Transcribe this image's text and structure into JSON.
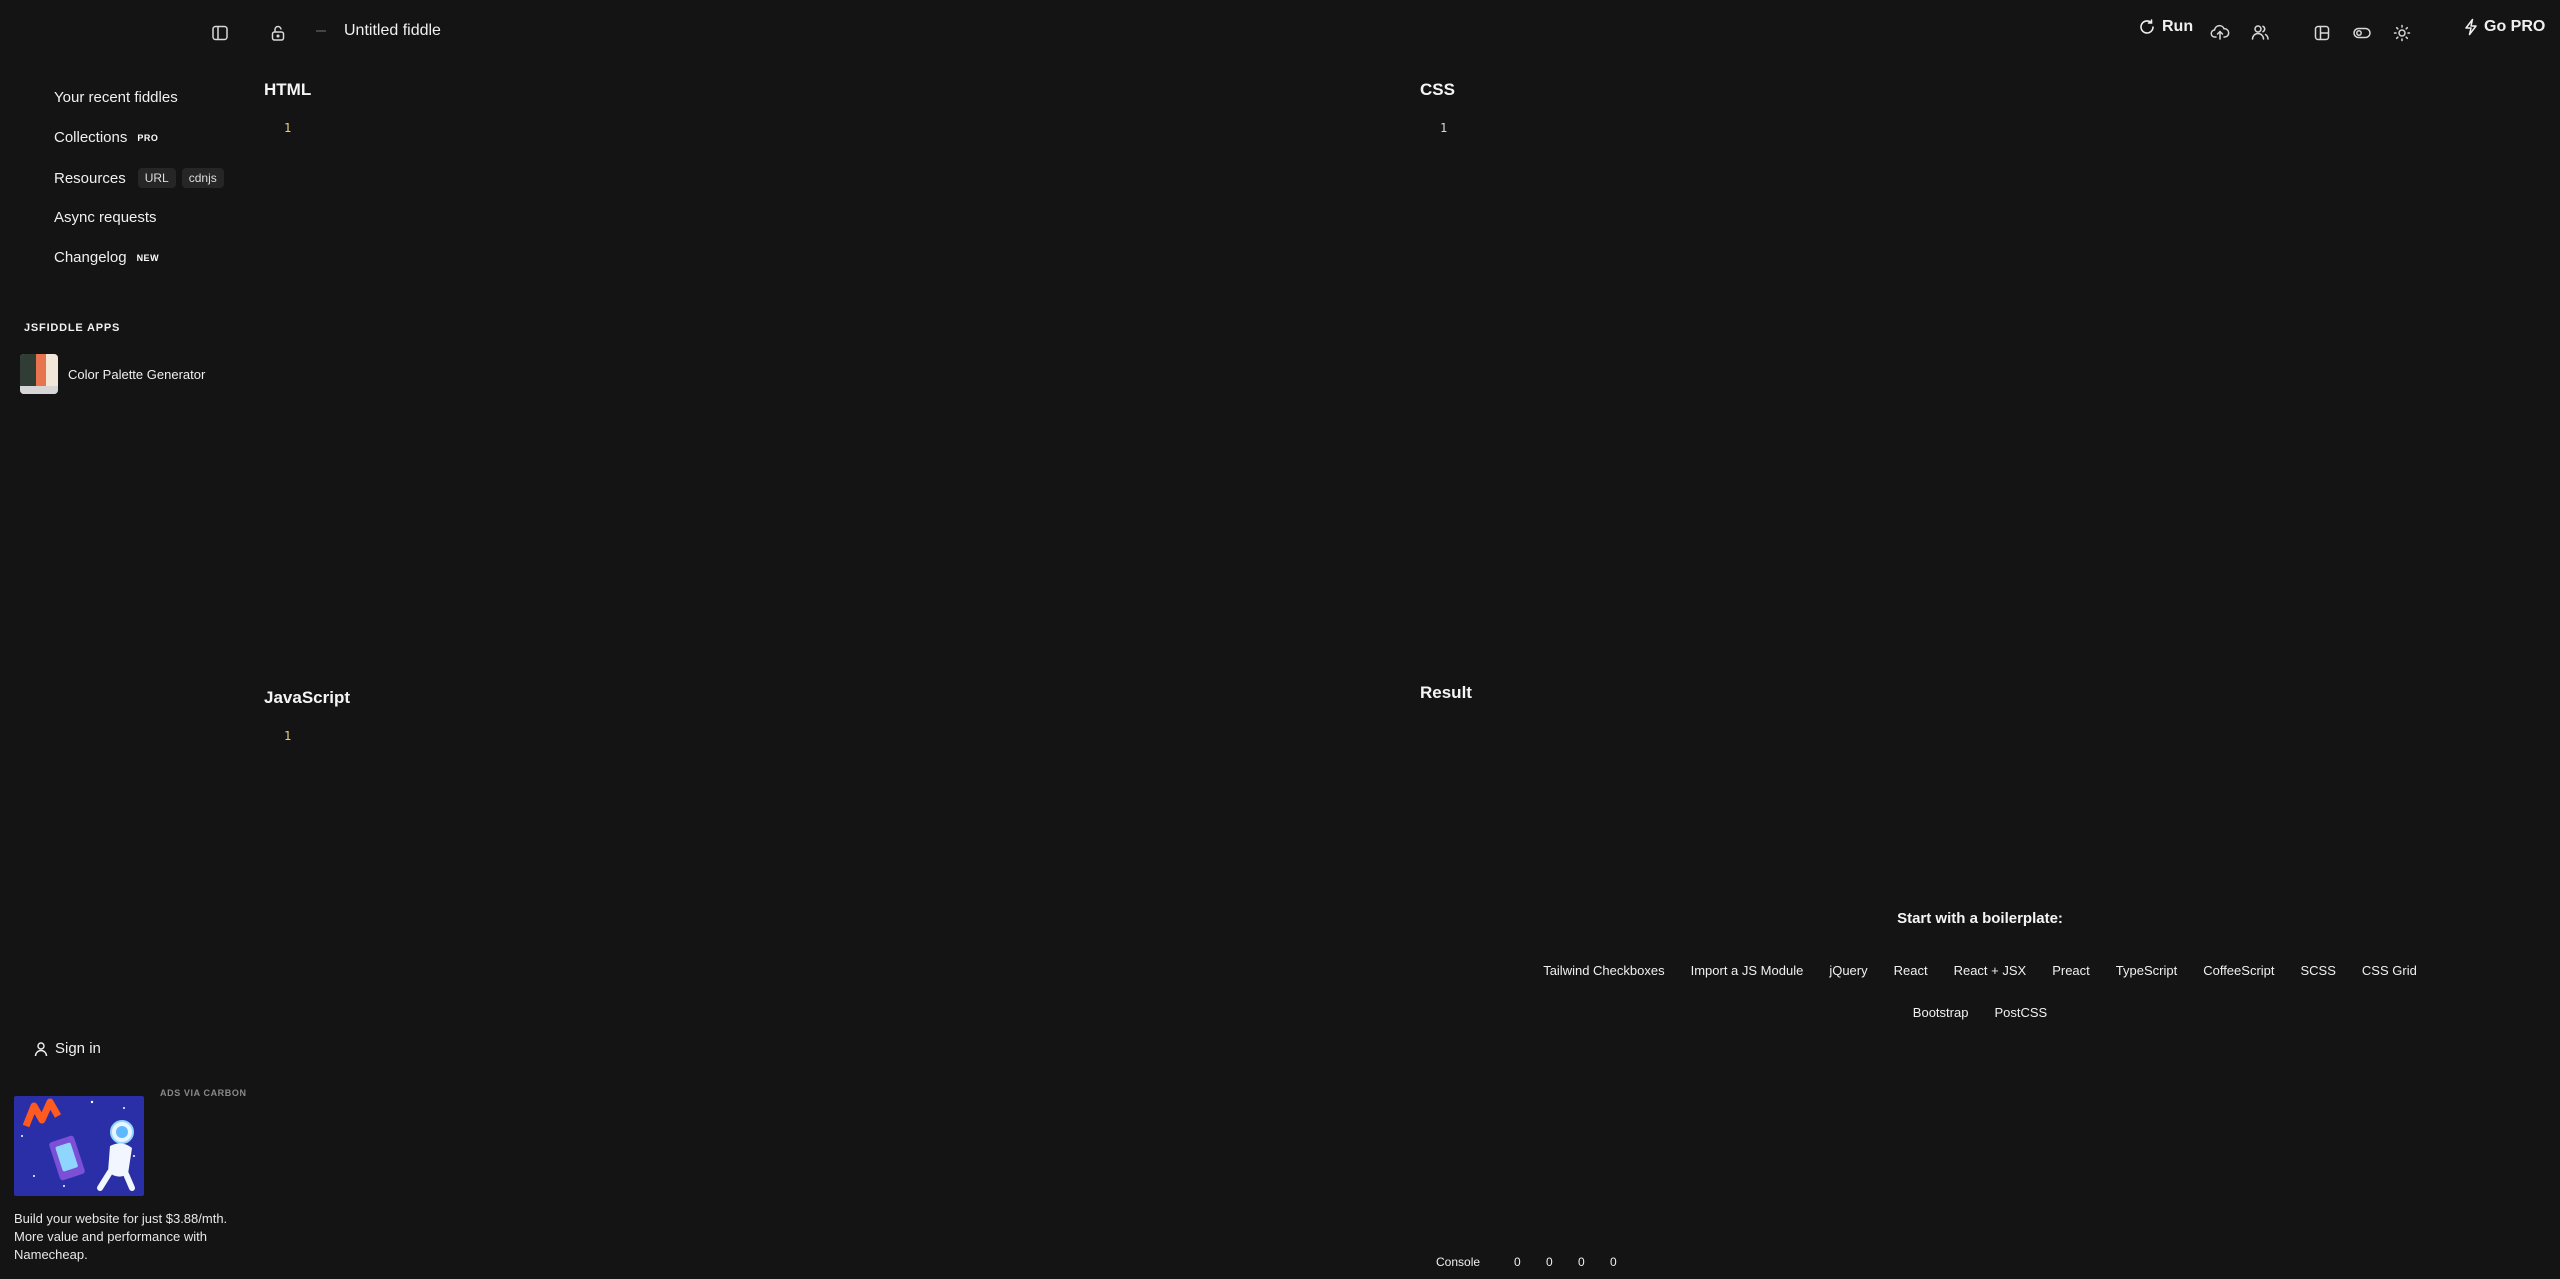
{
  "topbar": {
    "title": "Untitled fiddle",
    "run_label": "Run",
    "gopro_label": "Go PRO"
  },
  "sidebar": {
    "items": [
      {
        "label": "Your recent fiddles"
      },
      {
        "label": "Collections",
        "badge": "PRO"
      },
      {
        "label": "Resources",
        "chips": [
          "URL",
          "cdnjs"
        ]
      },
      {
        "label": "Async requests"
      },
      {
        "label": "Changelog",
        "badge": "NEW"
      }
    ],
    "apps_heading": "JSFIDDLE APPS",
    "apps": [
      {
        "label": "Color Palette Generator"
      }
    ],
    "signin_label": "Sign in"
  },
  "ad": {
    "label": "ADS VIA CARBON",
    "text": "Build your website for just $3.88/mth. More value and performance with Namecheap."
  },
  "panels": {
    "html": {
      "title": "HTML",
      "line": "1"
    },
    "css": {
      "title": "CSS",
      "line": "1"
    },
    "js": {
      "title": "JavaScript",
      "line": "1"
    },
    "result": {
      "title": "Result"
    }
  },
  "boilerplate": {
    "heading": "Start with a boilerplate:",
    "row1": [
      "Tailwind Checkboxes",
      "Import a JS Module",
      "jQuery",
      "React",
      "React + JSX",
      "Preact",
      "TypeScript",
      "CoffeeScript",
      "SCSS",
      "CSS Grid"
    ],
    "row2": [
      "Bootstrap",
      "PostCSS"
    ]
  },
  "console": {
    "label": "Console",
    "counts": [
      "0",
      "0",
      "0",
      "0"
    ]
  },
  "icons": {
    "sidebar_toggle": "sidebar-toggle-icon",
    "lock": "lock-open-icon",
    "run": "refresh-icon",
    "save": "cloud-upload-icon",
    "collab": "users-icon",
    "layout": "layout-icon",
    "toggle": "toggle-icon",
    "theme": "sun-icon",
    "gopro": "bolt-icon"
  }
}
